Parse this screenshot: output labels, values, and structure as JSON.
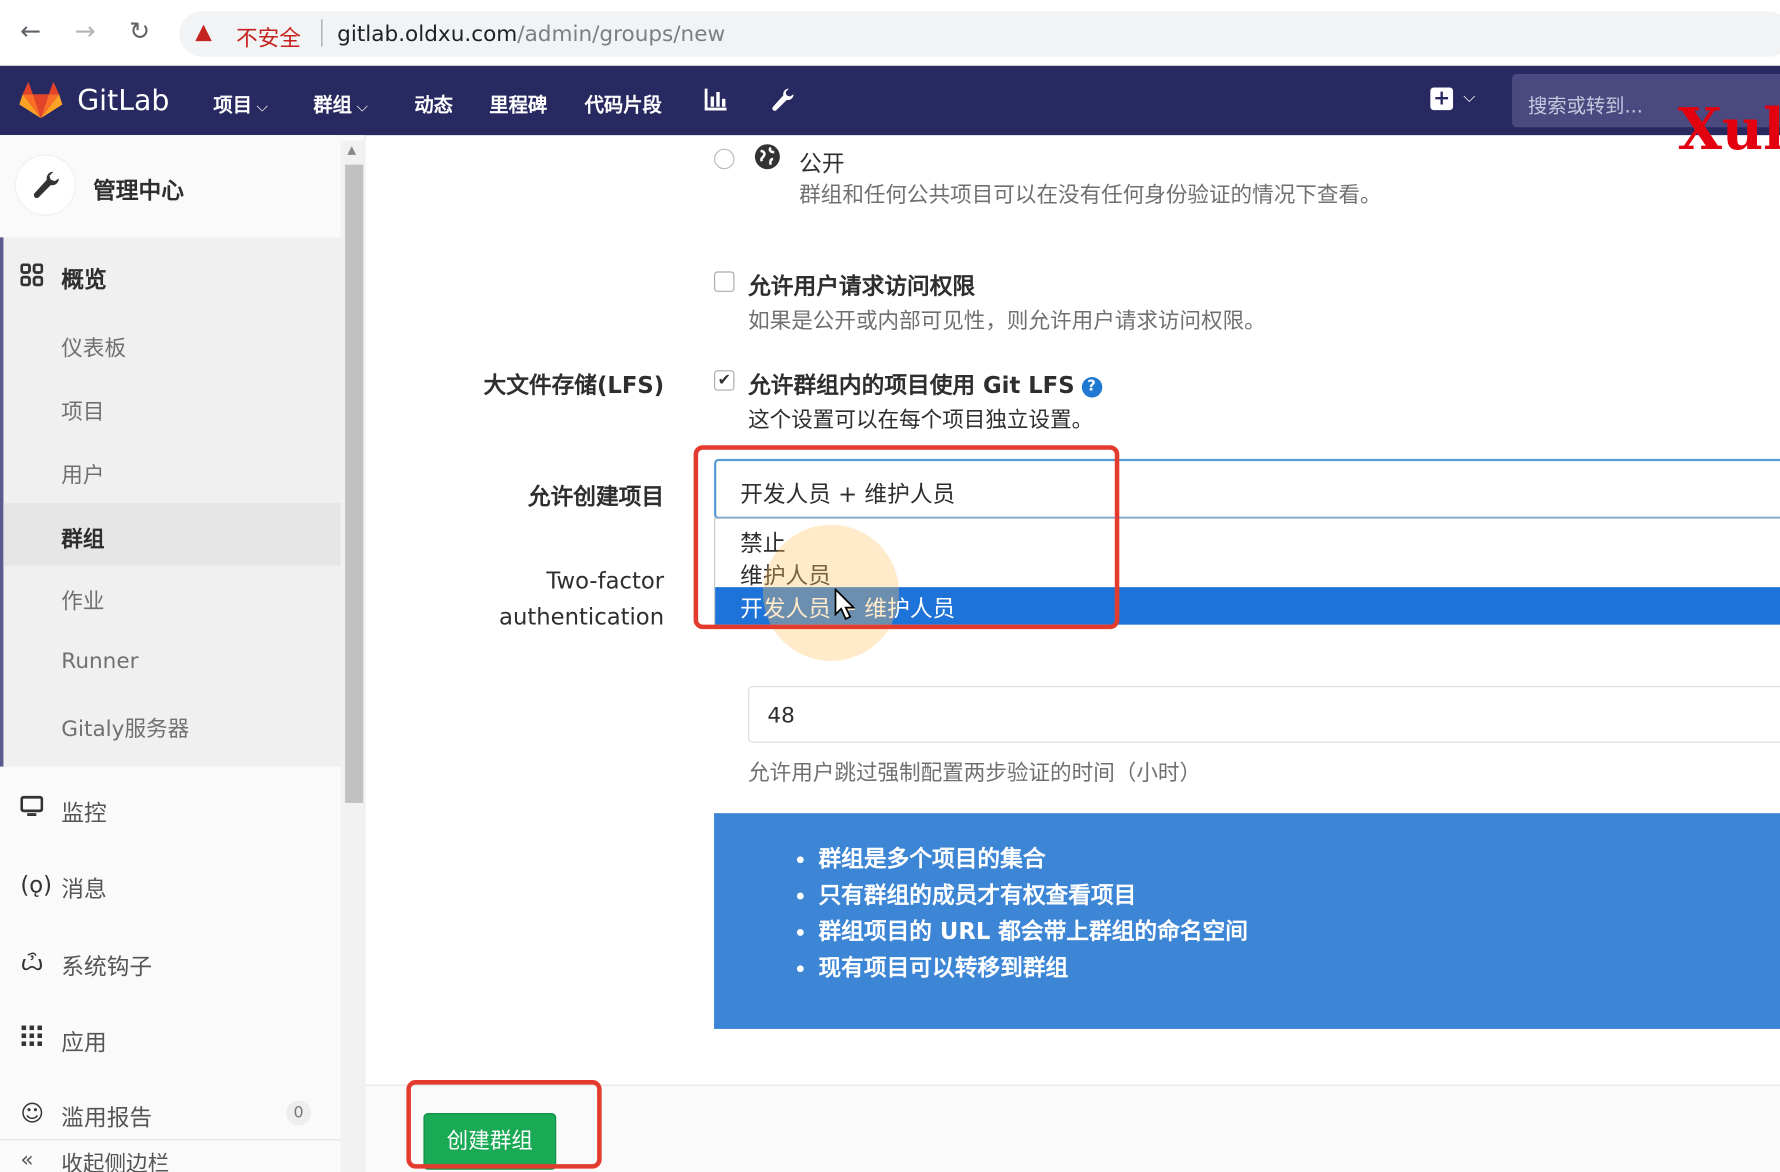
{
  "browser": {
    "url_warning": "不安全",
    "url_domain": "gitlab.oldxu.com",
    "url_path": "/admin/groups/new"
  },
  "nav": {
    "brand": "GitLab",
    "items": [
      {
        "label": "项目",
        "has_caret": true
      },
      {
        "label": "群组",
        "has_caret": true
      },
      {
        "label": "动态"
      },
      {
        "label": "里程碑"
      },
      {
        "label": "代码片段"
      }
    ],
    "search_placeholder": "搜索或转到...",
    "watermark": "Xul"
  },
  "sidebar": {
    "title": "管理中心",
    "overview_label": "概览",
    "sub_items": [
      "仪表板",
      "项目",
      "用户",
      "群组",
      "作业",
      "Runner",
      "Gitaly服务器"
    ],
    "active_sub": "群组",
    "items": [
      {
        "label": "监控",
        "icon": "monitor-icon"
      },
      {
        "label": "消息",
        "icon": "broadcast-icon"
      },
      {
        "label": "系统钩子",
        "icon": "hook-icon"
      },
      {
        "label": "应用",
        "icon": "apps-icon"
      },
      {
        "label": "滥用报告",
        "icon": "abuse-icon",
        "badge": "0"
      }
    ],
    "collapse_label": "收起侧边栏"
  },
  "form": {
    "visibility_public_label": "公开",
    "visibility_public_help": "群组和任何公共项目可以在没有任何身份验证的情况下查看。",
    "request_access_label": "允许用户请求访问权限",
    "request_access_help": "如果是公开或内部可见性，则允许用户请求访问权限。",
    "lfs_field_label": "大文件存储(LFS)",
    "lfs_checkbox_label": "允许群组内的项目使用 Git LFS",
    "lfs_help": "这个设置可以在每个项目独立设置。",
    "lfs_checked": true,
    "request_access_checked": false,
    "project_creation_label": "允许创建项目",
    "project_creation_value": "开发人员 + 维护人员",
    "project_creation_options": [
      "禁止",
      "维护人员",
      "开发人员 + 维护人员"
    ],
    "two_factor_label_1": "Two-factor",
    "two_factor_label_2": "authentication",
    "grace_period_value": "48",
    "grace_period_help": "允许用户跳过强制配置两步验证的时间（小时）"
  },
  "info_box": {
    "bullets": [
      "群组是多个项目的集合",
      "只有群组的成员才有权查看项目",
      "群组项目的 URL 都会带上群组的命名空间",
      "现有项目可以转移到群组"
    ]
  },
  "footer": {
    "create_button": "创建群组"
  },
  "colors": {
    "nav_bg": "#292961",
    "highlight_red": "#e33b2e",
    "info_blue": "#3d86d6",
    "select_blue": "#1e73d8",
    "create_green": "#1aaa55"
  }
}
